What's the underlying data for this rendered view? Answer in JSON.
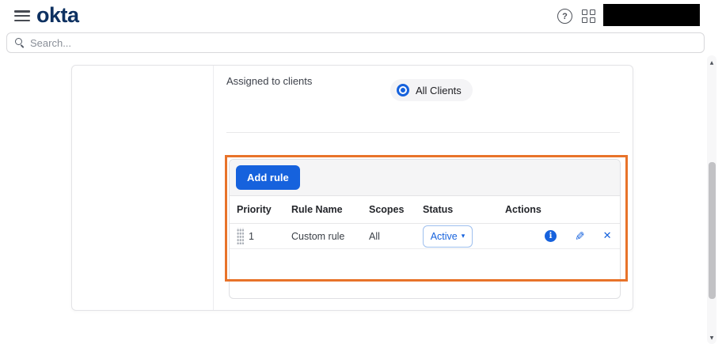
{
  "header": {
    "logo_text": "okta"
  },
  "search": {
    "placeholder": "Search..."
  },
  "content": {
    "assigned_to_clients_label": "Assigned to clients",
    "all_clients_label": "All Clients"
  },
  "rules_table": {
    "add_rule_button": "Add rule",
    "columns": [
      "Priority",
      "Rule Name",
      "Scopes",
      "Status",
      "Actions"
    ],
    "rows": [
      {
        "priority": "1",
        "rule_name": "Custom rule",
        "scopes": "All",
        "status": "Active"
      }
    ]
  },
  "icons": {
    "help": "?",
    "info": "i",
    "edit": "✎",
    "close": "✕",
    "caret_down": "▾",
    "scroll_up": "▲",
    "scroll_down": "▼"
  },
  "colors": {
    "accent_blue": "#1662dd",
    "logo_navy": "#0e3161",
    "highlight_orange": "#e8732a",
    "toolbar_gray": "#f5f5f6"
  }
}
